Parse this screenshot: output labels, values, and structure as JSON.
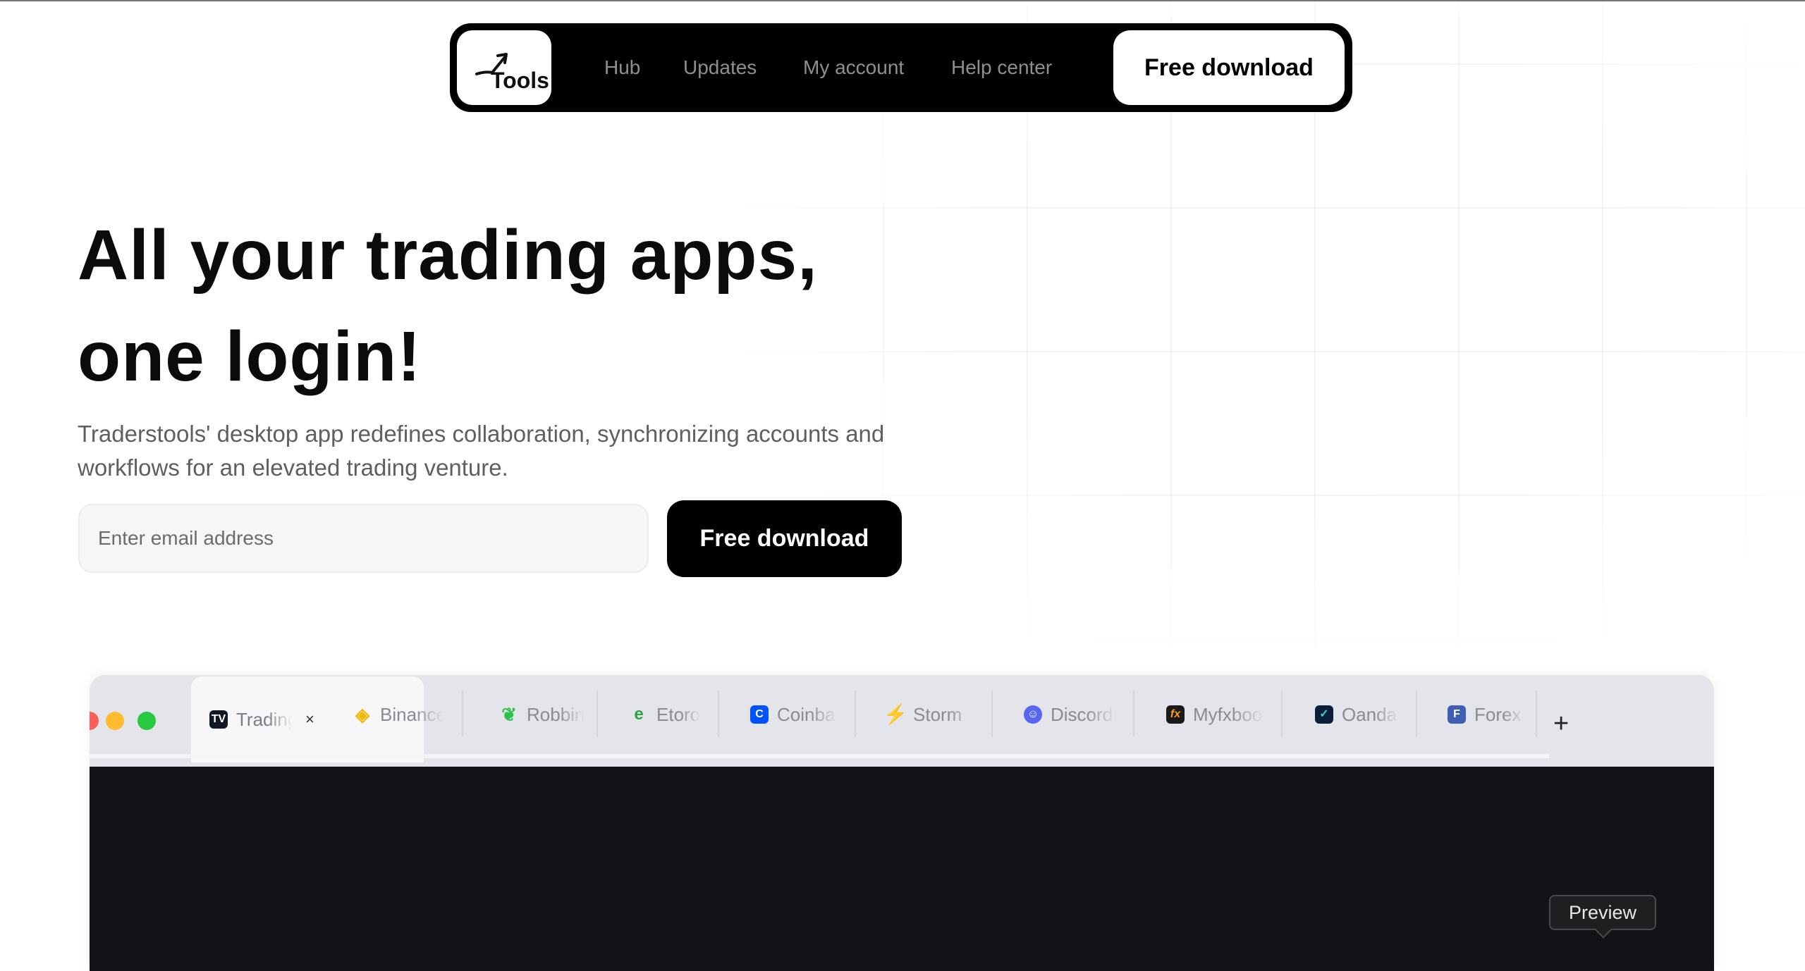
{
  "brand": {
    "logo_text": "Tools"
  },
  "nav": {
    "links": [
      "Hub",
      "Updates",
      "My account",
      "Help center"
    ],
    "cta": "Free download"
  },
  "hero": {
    "title_line1": "All your trading apps,",
    "title_line2": "one login!",
    "subtitle": "Traderstools' desktop app redefines collaboration, synchronizing accounts and workflows for an elevated trading venture.",
    "email_placeholder": "Enter email address",
    "cta": "Free download"
  },
  "app_preview": {
    "tabs": [
      {
        "label": "Trading",
        "icon": "tradingview-icon",
        "active": true
      },
      {
        "label": "Binance",
        "icon": "binance-icon"
      },
      {
        "label": "Robbin",
        "icon": "robinhood-icon"
      },
      {
        "label": "Etoro",
        "icon": "etoro-icon"
      },
      {
        "label": "Coinbase",
        "icon": "coinbase-icon"
      },
      {
        "label": "Storm",
        "icon": "storm-icon"
      },
      {
        "label": "Discord",
        "icon": "discord-icon"
      },
      {
        "label": "Myfxbook",
        "icon": "myfxbook-icon"
      },
      {
        "label": "Oanda",
        "icon": "oanda-icon"
      },
      {
        "label": "Forex",
        "icon": "forex-icon"
      }
    ],
    "close_glyph": "×",
    "add_tab_glyph": "+"
  },
  "tooltip": {
    "text": "Preview"
  },
  "colors": {
    "nav_bg": "#000000",
    "cta_dark": "#000000",
    "app_content_bg": "#141216",
    "traffic_red": "#fe5f57",
    "traffic_yellow": "#febc2e",
    "traffic_green": "#28c840"
  }
}
